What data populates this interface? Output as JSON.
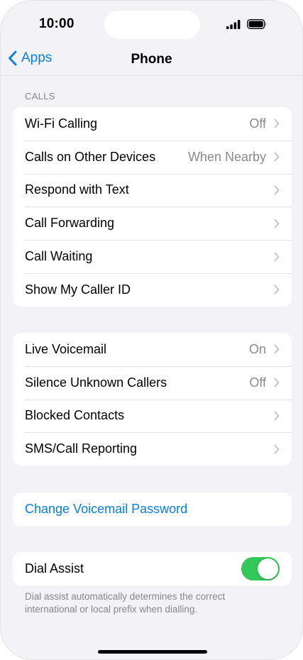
{
  "status": {
    "time": "10:00"
  },
  "nav": {
    "back_label": "Apps",
    "title": "Phone"
  },
  "calls_section": {
    "header": "CALLS",
    "rows": [
      {
        "label": "Wi-Fi Calling",
        "value": "Off"
      },
      {
        "label": "Calls on Other Devices",
        "value": "When Nearby"
      },
      {
        "label": "Respond with Text",
        "value": ""
      },
      {
        "label": "Call Forwarding",
        "value": ""
      },
      {
        "label": "Call Waiting",
        "value": ""
      },
      {
        "label": "Show My Caller ID",
        "value": ""
      }
    ]
  },
  "voicemail_section": {
    "rows": [
      {
        "label": "Live Voicemail",
        "value": "On"
      },
      {
        "label": "Silence Unknown Callers",
        "value": "Off"
      },
      {
        "label": "Blocked Contacts",
        "value": ""
      },
      {
        "label": "SMS/Call Reporting",
        "value": ""
      }
    ]
  },
  "password_section": {
    "label": "Change Voicemail Password"
  },
  "dial_assist": {
    "label": "Dial Assist",
    "enabled": true,
    "footer": "Dial assist automatically determines the correct international or local prefix when dialling."
  },
  "colors": {
    "accent": "#0a7ee6",
    "toggle_on": "#34c759",
    "background": "#f2f2f7"
  }
}
